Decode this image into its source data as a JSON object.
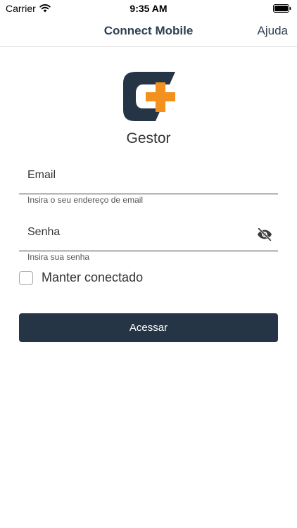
{
  "status_bar": {
    "carrier": "Carrier",
    "time": "9:35 AM"
  },
  "nav": {
    "title": "Connect Mobile",
    "help": "Ajuda"
  },
  "brand": {
    "name": "Gestor",
    "logo_colors": {
      "dark": "#263545",
      "accent": "#F4901E"
    }
  },
  "form": {
    "email": {
      "placeholder": "Email",
      "value": "",
      "helper": "Insira o seu endereço de email"
    },
    "password": {
      "placeholder": "Senha",
      "value": "",
      "helper": "Insira sua senha",
      "toggle_icon": "eye-off-icon"
    },
    "remember_label": "Manter conectado",
    "remember_checked": false,
    "submit_label": "Acessar"
  },
  "colors": {
    "primary": "#263545",
    "nav_text": "#2E3F52"
  }
}
